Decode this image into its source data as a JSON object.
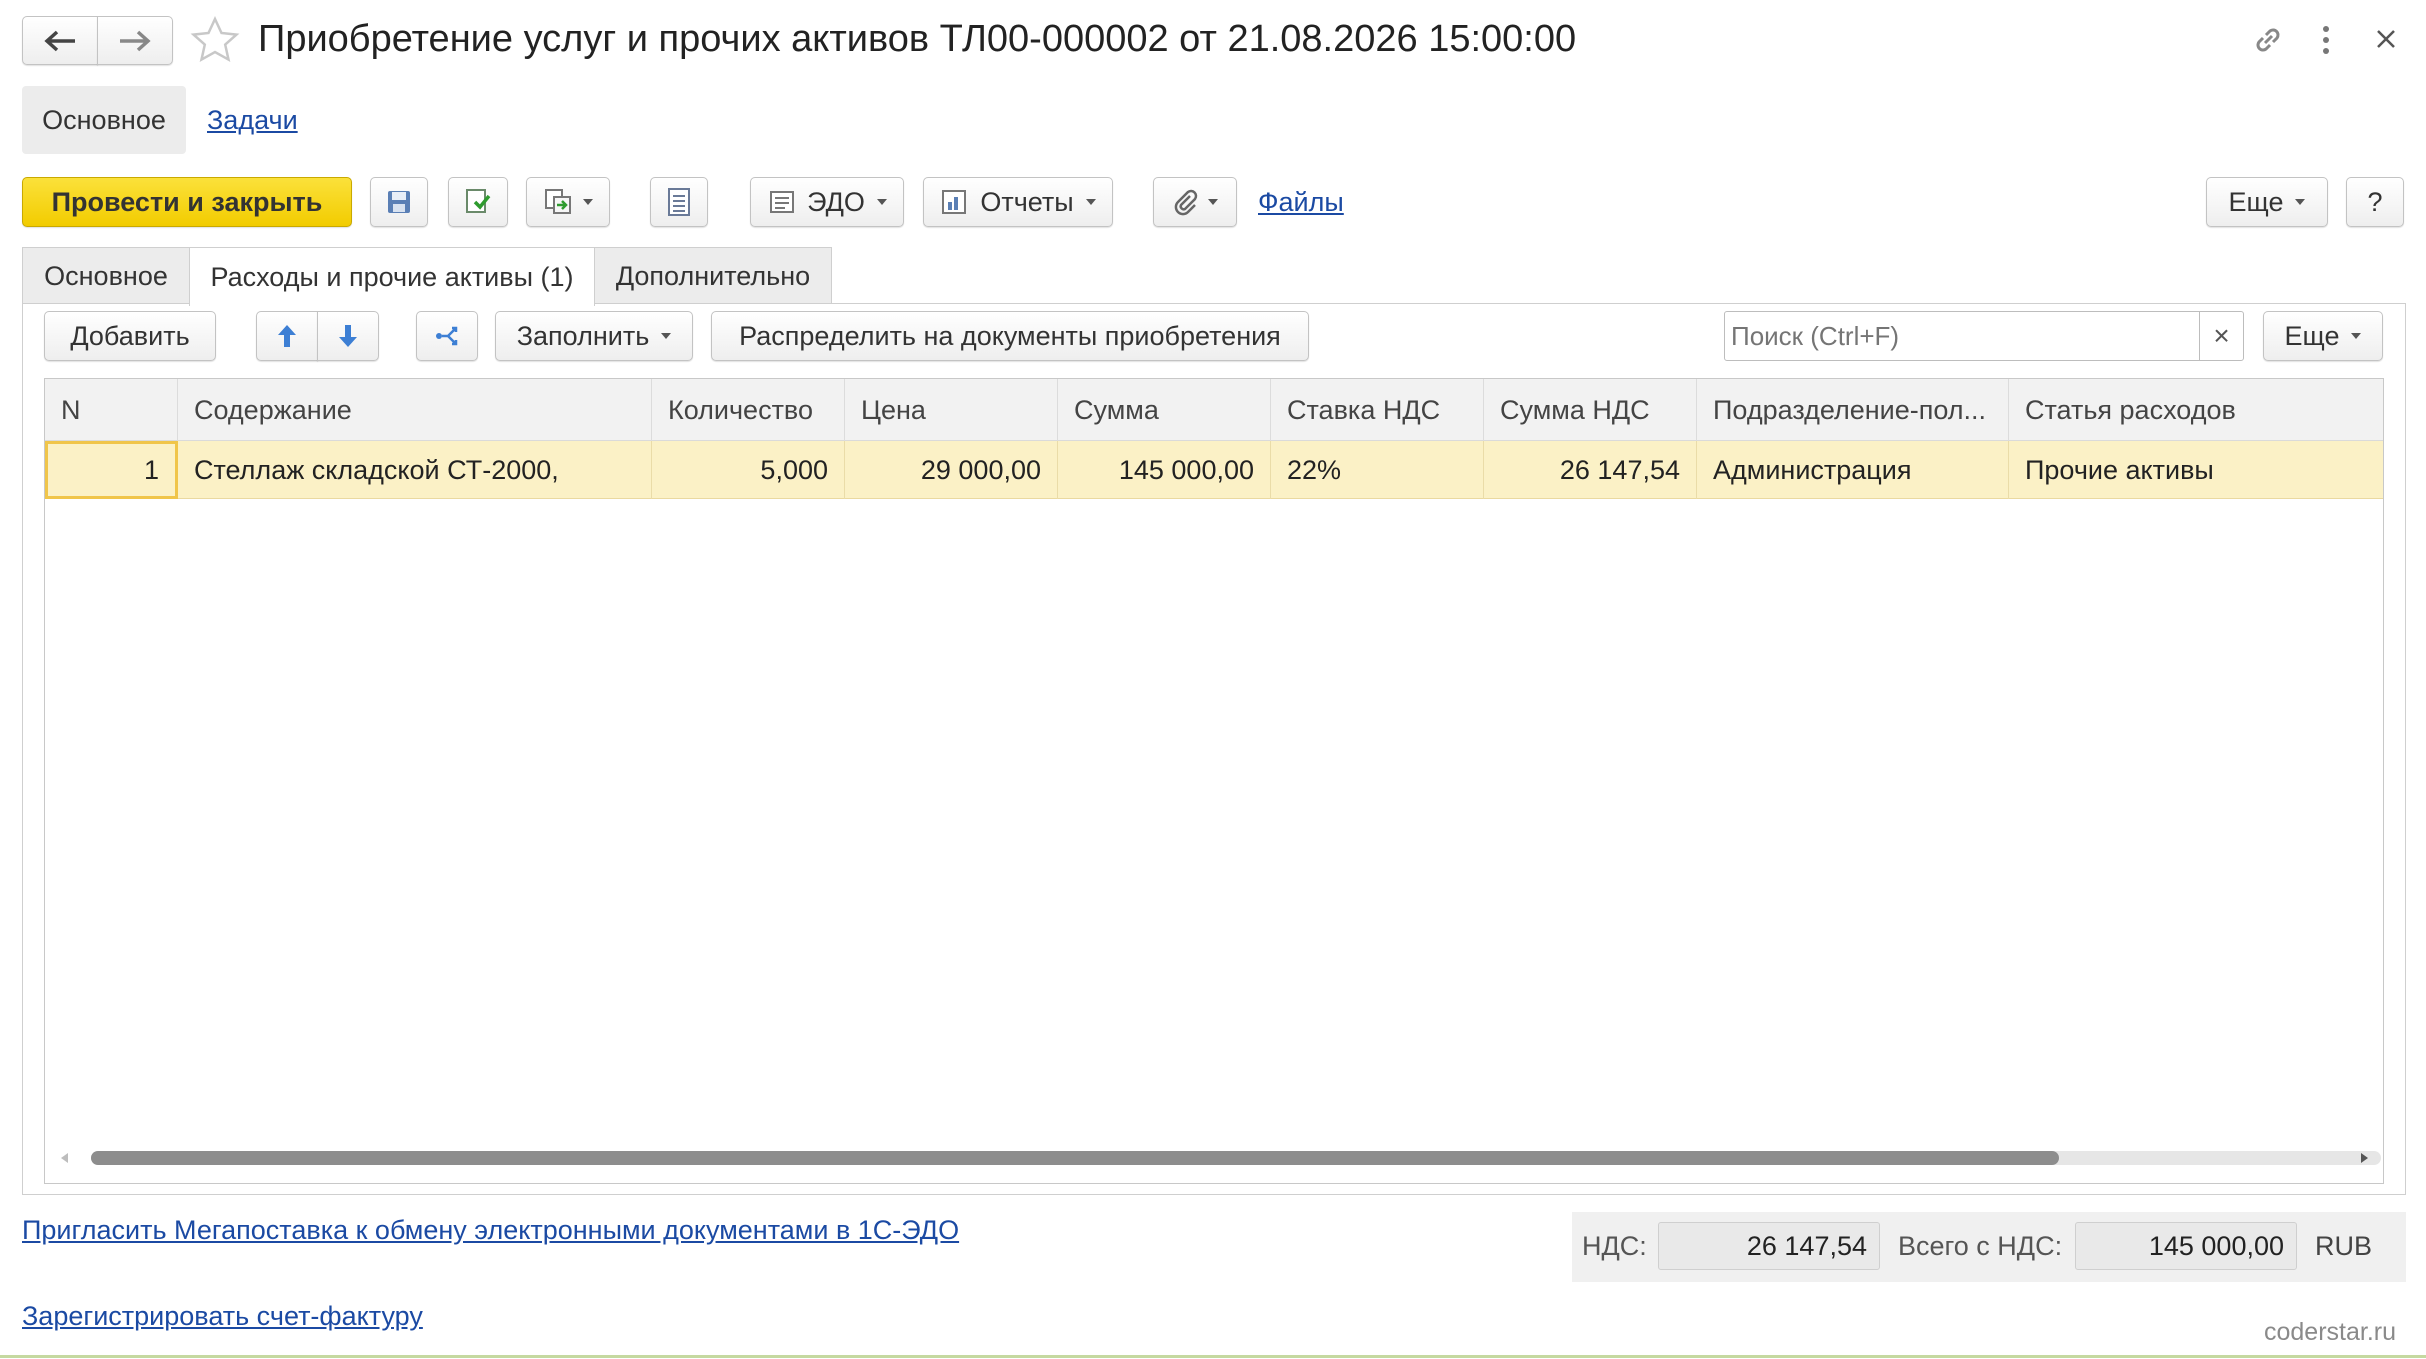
{
  "window": {
    "title": "Приобретение услуг и прочих активов ТЛ00-000002 от 21.08.2026 15:00:00"
  },
  "nav_tabs": {
    "main": "Основное",
    "tasks": "Задачи"
  },
  "toolbar": {
    "post_close": "Провести и закрыть",
    "edo": "ЭДО",
    "reports": "Отчеты",
    "files": "Файлы",
    "more": "Еще",
    "help": "?"
  },
  "tabs": [
    "Основное",
    "Расходы и прочие активы (1)",
    "Дополнительно"
  ],
  "table_toolbar": {
    "add": "Добавить",
    "fill": "Заполнить",
    "distribute": "Распределить на документы приобретения",
    "search_placeholder": "Поиск (Ctrl+F)",
    "clear": "×",
    "more": "Еще"
  },
  "table": {
    "columns": [
      "N",
      "Содержание",
      "Количество",
      "Цена",
      "Сумма",
      "Ставка НДС",
      "Сумма НДС",
      "Подразделение-пол...",
      "Статья расходов"
    ],
    "rows": [
      [
        "1",
        "Стеллаж складской СТ-2000,",
        "5,000",
        "29 000,00",
        "145 000,00",
        "22%",
        "26 147,54",
        "Администрация",
        "Прочие активы"
      ]
    ]
  },
  "footer": {
    "invite_link": "Пригласить Мегапоставка к обмену электронными документами в 1С-ЭДО",
    "register_link": "Зарегистрировать счет-фактуру",
    "vat_label": "НДС:",
    "vat_value": "26 147,54",
    "total_label": "Всего с НДС:",
    "total_value": "145 000,00",
    "currency": "RUB",
    "watermark": "coderstar.ru"
  },
  "colors": {
    "primary_button": "#f5d400",
    "selected_row": "#fbf1c6",
    "link": "#1b4aa3"
  }
}
